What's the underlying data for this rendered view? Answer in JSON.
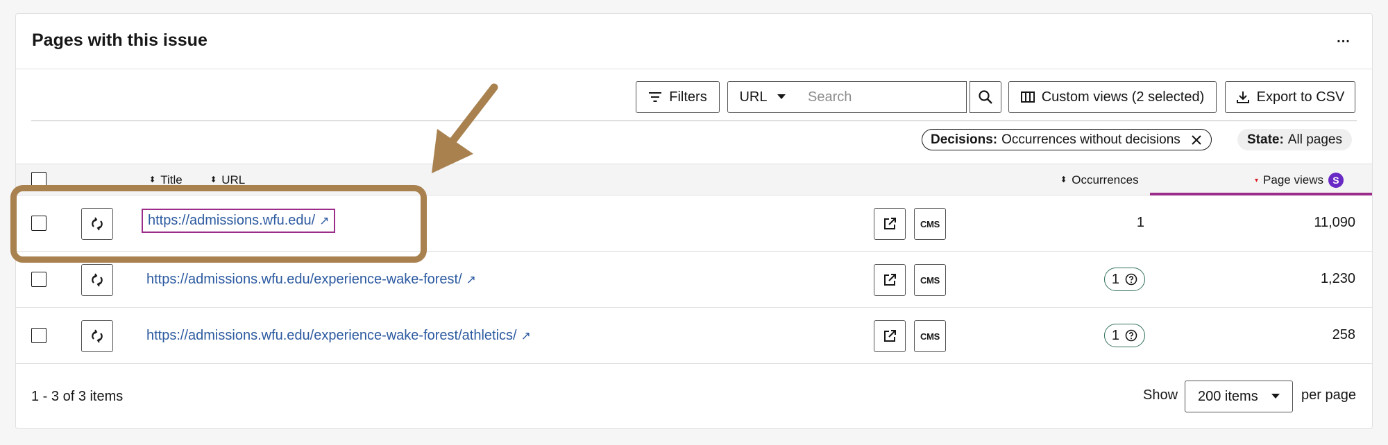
{
  "header": {
    "title": "Pages with this issue",
    "more_label": "..."
  },
  "toolbar": {
    "filters_label": "Filters",
    "field_select_value": "URL",
    "search_placeholder": "Search",
    "custom_views_label": "Custom views (2 selected)",
    "export_label": "Export to CSV"
  },
  "chips": {
    "decisions_key": "Decisions:",
    "decisions_value": "Occurrences without decisions",
    "state_key": "State:",
    "state_value": "All pages"
  },
  "table": {
    "columns": {
      "title": "Title",
      "url": "URL",
      "occurrences": "Occurrences",
      "page_views": "Page views",
      "page_views_badge": "S"
    },
    "cms_label": "CMS",
    "rows": [
      {
        "url": "https://admissions.wfu.edu/",
        "occurrences": "1",
        "occurrences_style": "plain",
        "page_views": "11,090"
      },
      {
        "url": "https://admissions.wfu.edu/experience-wake-forest/",
        "occurrences": "1",
        "occurrences_style": "pill",
        "page_views": "1,230"
      },
      {
        "url": "https://admissions.wfu.edu/experience-wake-forest/athletics/",
        "occurrences": "1",
        "occurrences_style": "pill",
        "page_views": "258"
      }
    ]
  },
  "footer": {
    "items_count": "1 - 3 of 3 items",
    "show_label": "Show",
    "per_page_value": "200 items",
    "per_page_label": "per page"
  },
  "colors": {
    "link": "#2c5aa0",
    "active_sort_underline": "#9b2c8a",
    "annotation": "#a8814f",
    "badge": "#6929c4"
  },
  "icons": {
    "external_link_glyph": "↗"
  }
}
